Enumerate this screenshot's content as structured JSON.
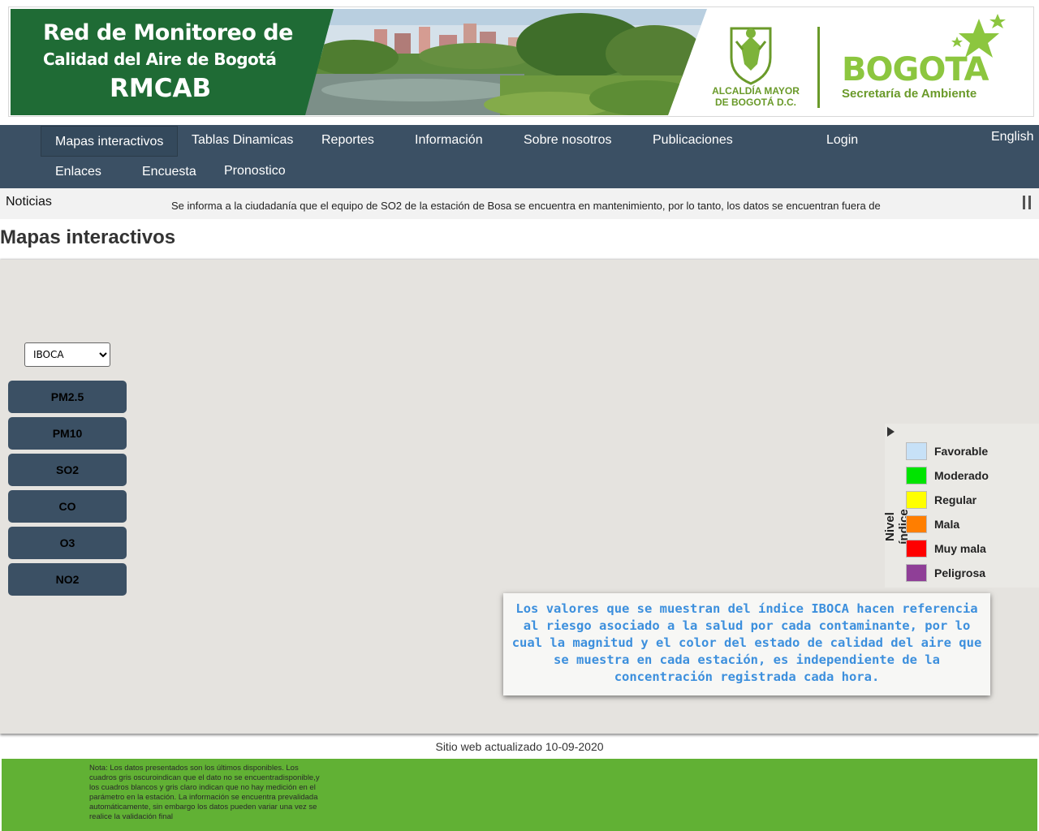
{
  "banner": {
    "title_line1": "Red de Monitoreo de",
    "title_line2": "Calidad del Aire de Bogotá",
    "title_line3": "RMCAB",
    "alcaldia_line1": "ALCALDÍA MAYOR",
    "alcaldia_line2": "DE BOGOTÁ D.C.",
    "bogota": "BOGOTA",
    "secretaria": "Secretaría de Ambiente"
  },
  "nav": {
    "items": [
      {
        "label": "Mapas interactivos",
        "active": true
      },
      {
        "label": "Tablas Dinamicas"
      },
      {
        "label": "Reportes"
      },
      {
        "label": "Información"
      },
      {
        "label": "Sobre nosotros"
      },
      {
        "label": "Publicaciones"
      },
      {
        "label": "Login"
      },
      {
        "label": "Enlaces"
      },
      {
        "label": "Encuesta"
      },
      {
        "label": "Pronostico"
      }
    ],
    "language": "English"
  },
  "news": {
    "label": "Noticias",
    "text": "Se informa a la ciudadanía que el equipo de SO2 de la estación de Bosa se encuentra en mantenimiento, por lo tanto, los datos se encuentran fuera de"
  },
  "page_title": "Mapas interactivos",
  "map": {
    "select_value": "IBOCA",
    "select_options": [
      "IBOCA"
    ],
    "pollutant_buttons": [
      "PM2.5",
      "PM10",
      "SO2",
      "CO",
      "O3",
      "NO2"
    ],
    "legend": {
      "axis_label": "Nivel índice",
      "items": [
        {
          "label": "Favorable",
          "color": "#c7e1f7"
        },
        {
          "label": "Moderado",
          "color": "#00e400"
        },
        {
          "label": "Regular",
          "color": "#ffff00"
        },
        {
          "label": "Mala",
          "color": "#ff7e00"
        },
        {
          "label": "Muy mala",
          "color": "#ff0000"
        },
        {
          "label": "Peligrosa",
          "color": "#8f3f97"
        }
      ]
    },
    "info_text": "Los valores que se muestran del índice IBOCA hacen referencia al riesgo asociado a la salud por cada contaminante, por lo cual la magnitud y el color del estado de calidad del aire que se muestra en cada estación, es independiente de la concentración registrada cada hora."
  },
  "updated": "Sitio web actualizado 10-09-2020",
  "footer_note": "Nota: Los datos presentados son los últimos disponibles. Los cuadros gris oscuroindican que el dato no se encuentradisponible,y los cuadros blancos y gris claro indican que no hay medición en el parámetro en la estación. La información se encuentra prevalidada automáticamente, sin embargo los datos pueden variar una vez se realice la validación final"
}
